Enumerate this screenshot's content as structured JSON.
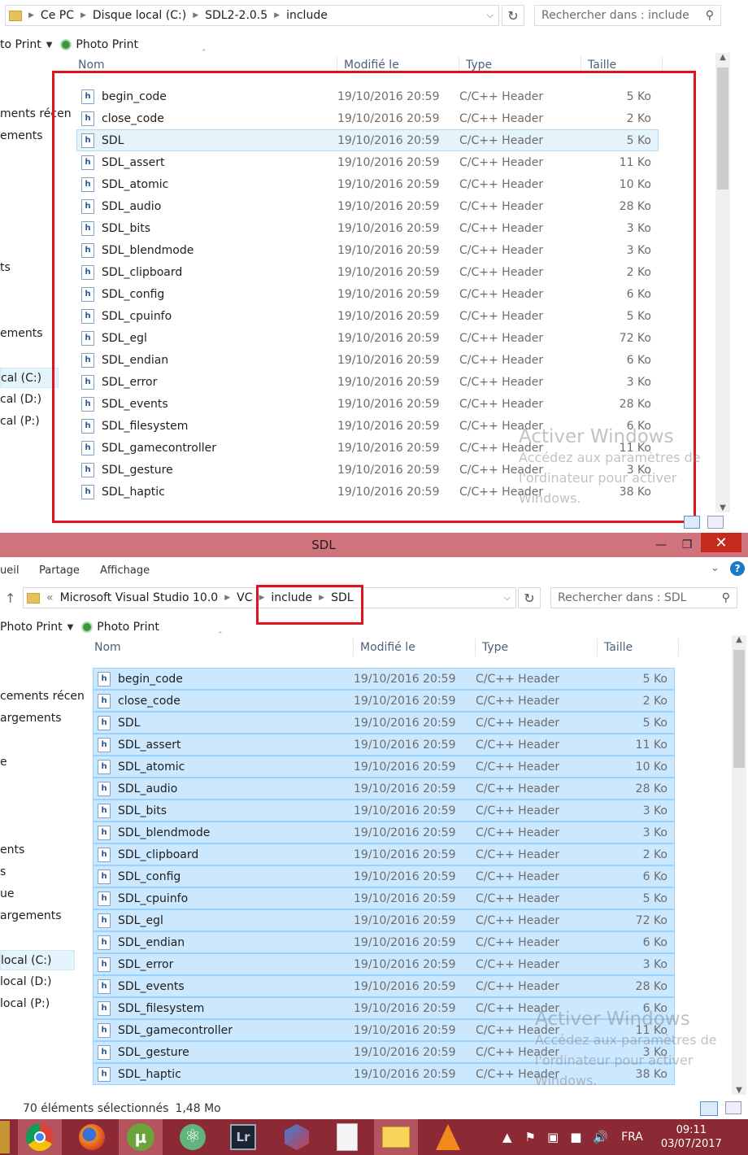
{
  "top_window": {
    "breadcrumb": [
      "Ce PC",
      "Disque local (C:)",
      "SDL2-2.0.5",
      "include"
    ],
    "search_placeholder": "Rechercher dans : include",
    "toolbar": [
      {
        "label": "to Print"
      },
      {
        "label": "Photo Print"
      }
    ],
    "nav_items": [
      "ments récen",
      "ements",
      "ts",
      "ements",
      "cal (C:)",
      "cal (D:)",
      "cal (P:)"
    ],
    "columns": {
      "name": "Nom",
      "modified": "Modifié le",
      "type": "Type",
      "size": "Taille"
    },
    "files": [
      {
        "name": "begin_code",
        "modified": "19/10/2016 20:59",
        "type": "C/C++ Header",
        "size": "5 Ko"
      },
      {
        "name": "close_code",
        "modified": "19/10/2016 20:59",
        "type": "C/C++ Header",
        "size": "2 Ko"
      },
      {
        "name": "SDL",
        "modified": "19/10/2016 20:59",
        "type": "C/C++ Header",
        "size": "5 Ko"
      },
      {
        "name": "SDL_assert",
        "modified": "19/10/2016 20:59",
        "type": "C/C++ Header",
        "size": "11 Ko"
      },
      {
        "name": "SDL_atomic",
        "modified": "19/10/2016 20:59",
        "type": "C/C++ Header",
        "size": "10 Ko"
      },
      {
        "name": "SDL_audio",
        "modified": "19/10/2016 20:59",
        "type": "C/C++ Header",
        "size": "28 Ko"
      },
      {
        "name": "SDL_bits",
        "modified": "19/10/2016 20:59",
        "type": "C/C++ Header",
        "size": "3 Ko"
      },
      {
        "name": "SDL_blendmode",
        "modified": "19/10/2016 20:59",
        "type": "C/C++ Header",
        "size": "3 Ko"
      },
      {
        "name": "SDL_clipboard",
        "modified": "19/10/2016 20:59",
        "type": "C/C++ Header",
        "size": "2 Ko"
      },
      {
        "name": "SDL_config",
        "modified": "19/10/2016 20:59",
        "type": "C/C++ Header",
        "size": "6 Ko"
      },
      {
        "name": "SDL_cpuinfo",
        "modified": "19/10/2016 20:59",
        "type": "C/C++ Header",
        "size": "5 Ko"
      },
      {
        "name": "SDL_egl",
        "modified": "19/10/2016 20:59",
        "type": "C/C++ Header",
        "size": "72 Ko"
      },
      {
        "name": "SDL_endian",
        "modified": "19/10/2016 20:59",
        "type": "C/C++ Header",
        "size": "6 Ko"
      },
      {
        "name": "SDL_error",
        "modified": "19/10/2016 20:59",
        "type": "C/C++ Header",
        "size": "3 Ko"
      },
      {
        "name": "SDL_events",
        "modified": "19/10/2016 20:59",
        "type": "C/C++ Header",
        "size": "28 Ko"
      },
      {
        "name": "SDL_filesystem",
        "modified": "19/10/2016 20:59",
        "type": "C/C++ Header",
        "size": "6 Ko"
      },
      {
        "name": "SDL_gamecontroller",
        "modified": "19/10/2016 20:59",
        "type": "C/C++ Header",
        "size": "11 Ko"
      },
      {
        "name": "SDL_gesture",
        "modified": "19/10/2016 20:59",
        "type": "C/C++ Header",
        "size": "3 Ko"
      },
      {
        "name": "SDL_haptic",
        "modified": "19/10/2016 20:59",
        "type": "C/C++ Header",
        "size": "38 Ko"
      }
    ],
    "watermark": {
      "title": "Activer Windows",
      "line1": "Accédez aux paramètres de",
      "line2": "l'ordinateur pour activer",
      "line3": "Windows."
    }
  },
  "bottom_window": {
    "title": "SDL",
    "ribbon_tabs": [
      "ueil",
      "Partage",
      "Affichage"
    ],
    "breadcrumb_prefix": "«",
    "breadcrumb": [
      "Microsoft Visual Studio 10.0",
      "VC",
      "include",
      "SDL"
    ],
    "search_placeholder": "Rechercher dans : SDL",
    "toolbar": [
      {
        "label": "Photo Print"
      },
      {
        "label": "Photo Print"
      }
    ],
    "nav_items": [
      "cements récen",
      "argements",
      "e",
      "ents",
      "s",
      "ue",
      "argements",
      "local (C:)",
      "local (D:)",
      "local (P:)"
    ],
    "columns": {
      "name": "Nom",
      "modified": "Modifié le",
      "type": "Type",
      "size": "Taille"
    },
    "files": [
      {
        "name": "begin_code",
        "modified": "19/10/2016 20:59",
        "type": "C/C++ Header",
        "size": "5 Ko"
      },
      {
        "name": "close_code",
        "modified": "19/10/2016 20:59",
        "type": "C/C++ Header",
        "size": "2 Ko"
      },
      {
        "name": "SDL",
        "modified": "19/10/2016 20:59",
        "type": "C/C++ Header",
        "size": "5 Ko"
      },
      {
        "name": "SDL_assert",
        "modified": "19/10/2016 20:59",
        "type": "C/C++ Header",
        "size": "11 Ko"
      },
      {
        "name": "SDL_atomic",
        "modified": "19/10/2016 20:59",
        "type": "C/C++ Header",
        "size": "10 Ko"
      },
      {
        "name": "SDL_audio",
        "modified": "19/10/2016 20:59",
        "type": "C/C++ Header",
        "size": "28 Ko"
      },
      {
        "name": "SDL_bits",
        "modified": "19/10/2016 20:59",
        "type": "C/C++ Header",
        "size": "3 Ko"
      },
      {
        "name": "SDL_blendmode",
        "modified": "19/10/2016 20:59",
        "type": "C/C++ Header",
        "size": "3 Ko"
      },
      {
        "name": "SDL_clipboard",
        "modified": "19/10/2016 20:59",
        "type": "C/C++ Header",
        "size": "2 Ko"
      },
      {
        "name": "SDL_config",
        "modified": "19/10/2016 20:59",
        "type": "C/C++ Header",
        "size": "6 Ko"
      },
      {
        "name": "SDL_cpuinfo",
        "modified": "19/10/2016 20:59",
        "type": "C/C++ Header",
        "size": "5 Ko"
      },
      {
        "name": "SDL_egl",
        "modified": "19/10/2016 20:59",
        "type": "C/C++ Header",
        "size": "72 Ko"
      },
      {
        "name": "SDL_endian",
        "modified": "19/10/2016 20:59",
        "type": "C/C++ Header",
        "size": "6 Ko"
      },
      {
        "name": "SDL_error",
        "modified": "19/10/2016 20:59",
        "type": "C/C++ Header",
        "size": "3 Ko"
      },
      {
        "name": "SDL_events",
        "modified": "19/10/2016 20:59",
        "type": "C/C++ Header",
        "size": "28 Ko"
      },
      {
        "name": "SDL_filesystem",
        "modified": "19/10/2016 20:59",
        "type": "C/C++ Header",
        "size": "6 Ko"
      },
      {
        "name": "SDL_gamecontroller",
        "modified": "19/10/2016 20:59",
        "type": "C/C++ Header",
        "size": "11 Ko"
      },
      {
        "name": "SDL_gesture",
        "modified": "19/10/2016 20:59",
        "type": "C/C++ Header",
        "size": "3 Ko"
      },
      {
        "name": "SDL_haptic",
        "modified": "19/10/2016 20:59",
        "type": "C/C++ Header",
        "size": "38 Ko"
      }
    ],
    "status": {
      "count": "70 éléments sélectionnés",
      "size": "1,48 Mo"
    },
    "watermark": {
      "title": "Activer Windows",
      "line1": "Accédez aux paramètres de",
      "line2": "l'ordinateur pour activer",
      "line3": "Windows."
    }
  },
  "taskbar": {
    "apps": [
      {
        "icon": "chrome-icon"
      },
      {
        "icon": "firefox-icon"
      },
      {
        "icon": "utorrent-icon"
      },
      {
        "icon": "atom-icon"
      },
      {
        "icon": "lightroom-icon",
        "label": "Lr"
      },
      {
        "icon": "visual-studio-icon"
      },
      {
        "icon": "notepad-icon"
      },
      {
        "icon": "paint-icon"
      },
      {
        "icon": "vlc-icon"
      }
    ],
    "language": "FRA",
    "time": "09:11",
    "date": "03/07/2017"
  },
  "colors": {
    "selection": "#cce8ff",
    "selection_border": "#99d1ff",
    "highlight_box": "#e0141e",
    "titlebar": "#d0737c",
    "taskbar": "#8b2a35"
  }
}
